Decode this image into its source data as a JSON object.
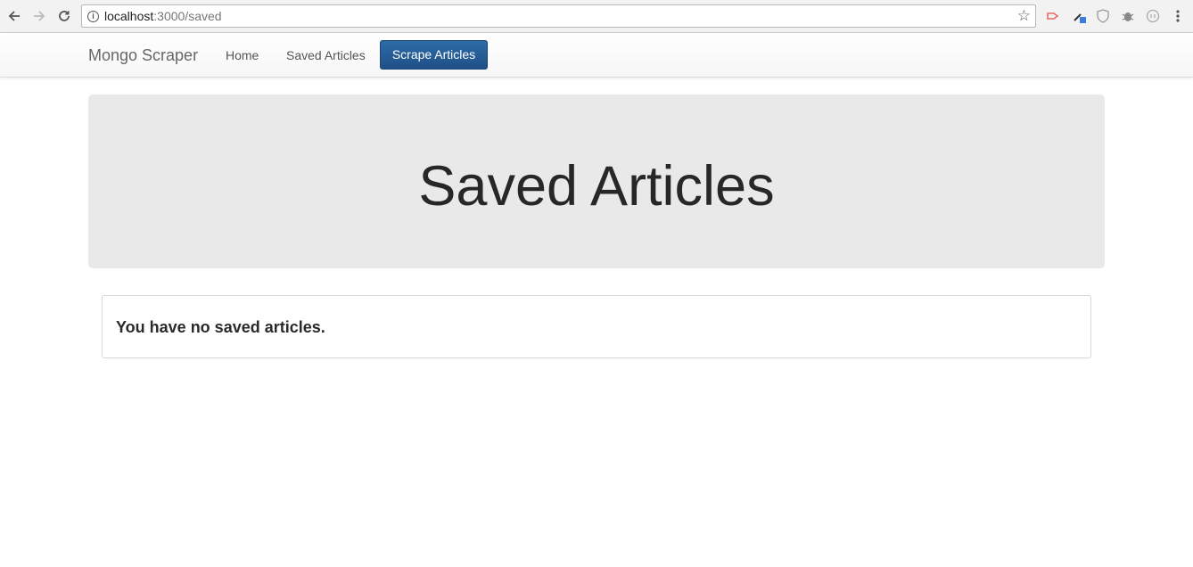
{
  "browser": {
    "url_host": "localhost",
    "url_path": ":3000/saved"
  },
  "navbar": {
    "brand": "Mongo Scraper",
    "links": [
      "Home",
      "Saved Articles"
    ],
    "scrape_button": "Scrape Articles"
  },
  "jumbotron": {
    "title": "Saved Articles"
  },
  "panel": {
    "message": "You have no saved articles."
  },
  "icons": {
    "back": "arrow-left-icon",
    "forward": "arrow-right-icon",
    "reload": "reload-icon",
    "site_info": "info-icon",
    "bookmark": "star-icon",
    "menu": "kebab-menu-icon"
  },
  "colors": {
    "primary_button": "#1f4f86",
    "jumbotron_bg": "#e9e9e9"
  }
}
